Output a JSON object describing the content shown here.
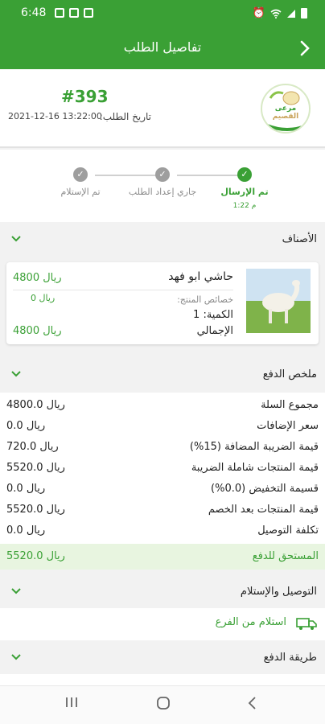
{
  "status_bar": {
    "time": "6:48"
  },
  "header": {
    "title": "تفاصيل الطلب"
  },
  "order": {
    "number": "#393",
    "date_label": "تاريخ الطلب:",
    "date": "2021-12-16 13:22:00"
  },
  "logo": {
    "line1": "مرعى",
    "line2": "القصيم"
  },
  "tracker": {
    "steps": [
      {
        "label": "تم الإرسال",
        "time": "1:22 م",
        "done": true
      },
      {
        "label": "جاري إعداد الطلب",
        "done": false
      },
      {
        "label": "تم الإستلام",
        "done": false
      }
    ]
  },
  "items_section": {
    "title": "الأصناف"
  },
  "item": {
    "name": "حاشي ابو فهد",
    "price": "4800 ريال",
    "props_label": "خصائص المنتج:",
    "props_price": "0 ريال",
    "qty_label": "الكمية: 1",
    "total_label": "الإجمالي",
    "total": "4800 ريال"
  },
  "payment_summary": {
    "title": "ملخص الدفع",
    "rows": [
      {
        "label": "مجموع السلة",
        "value": "4800.0 ريال"
      },
      {
        "label": "سعر الإضافات",
        "value": "0.0 ريال"
      },
      {
        "label": "قيمة الضريبة المضافة (15%)",
        "value": "720.0 ريال"
      },
      {
        "label": "قيمة المنتجات شاملة الضريبة",
        "value": "5520.0 ريال"
      },
      {
        "label": "قسيمة التخفيض (0.0%)",
        "value": "0.0 ريال"
      },
      {
        "label": "قيمة المنتجات بعد الخصم",
        "value": "5520.0 ريال"
      },
      {
        "label": "تكلفة التوصيل",
        "value": "0.0 ريال"
      }
    ],
    "due_label": "المستحق للدفع",
    "due_value": "5520.0 ريال"
  },
  "delivery_section": {
    "title": "التوصيل والإستلام",
    "method": "استلام من الفرع"
  },
  "payment_method_section": {
    "title": "طريقة الدفع"
  },
  "colors": {
    "primary": "#3aa035",
    "background": "#f2f2f2",
    "due_bg": "#e8f5e0"
  },
  "icons": [
    "back-arrow-icon",
    "chevron-down-icon",
    "check-icon",
    "truck-icon"
  ]
}
